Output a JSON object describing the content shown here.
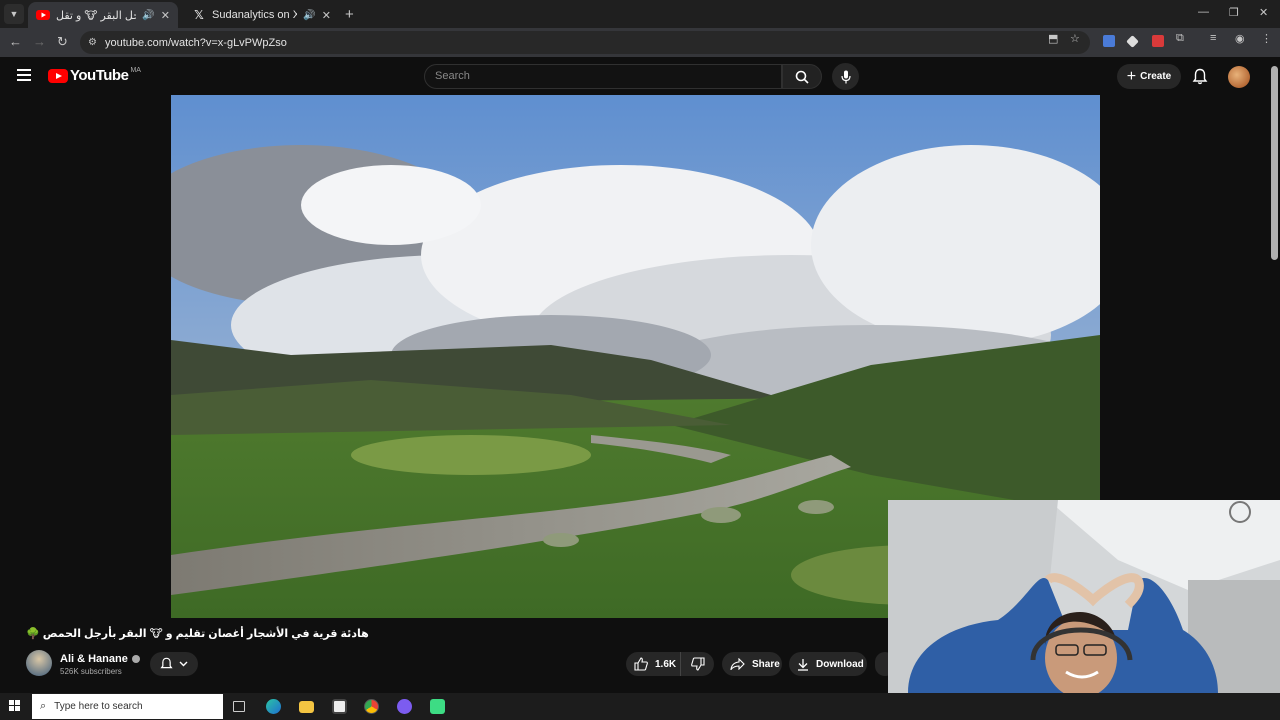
{
  "browser": {
    "tabs": [
      {
        "title": "الحمص بأرجل البقر 🐮 و تقل",
        "audio_icon": "speaker-icon",
        "active": true
      },
      {
        "title": "Sudanalytics on X: \"Lo desp",
        "audio_icon": "speaker-icon",
        "active": false
      }
    ],
    "url": "youtube.com/watch?v=x-gLvPWpZso"
  },
  "youtube": {
    "logo_text": "YouTube",
    "country_code": "MA",
    "search_placeholder": "Search",
    "create_label": "Create",
    "video_title": "هادئة قرية في الأشجار أغصان تقليم و 🐮 البقر بأرجل الحمص 🌳",
    "channel_name": "Ali & Hanane",
    "subscribers": "526K subscribers",
    "likes": "1.6K",
    "share_label": "Share",
    "download_label": "Download"
  },
  "taskbar": {
    "search_placeholder": "Type here to search"
  },
  "colors": {
    "accent_red": "#ff0000",
    "chrome_dark": "#1f1f1f",
    "page_bg": "#0f0f0f"
  }
}
